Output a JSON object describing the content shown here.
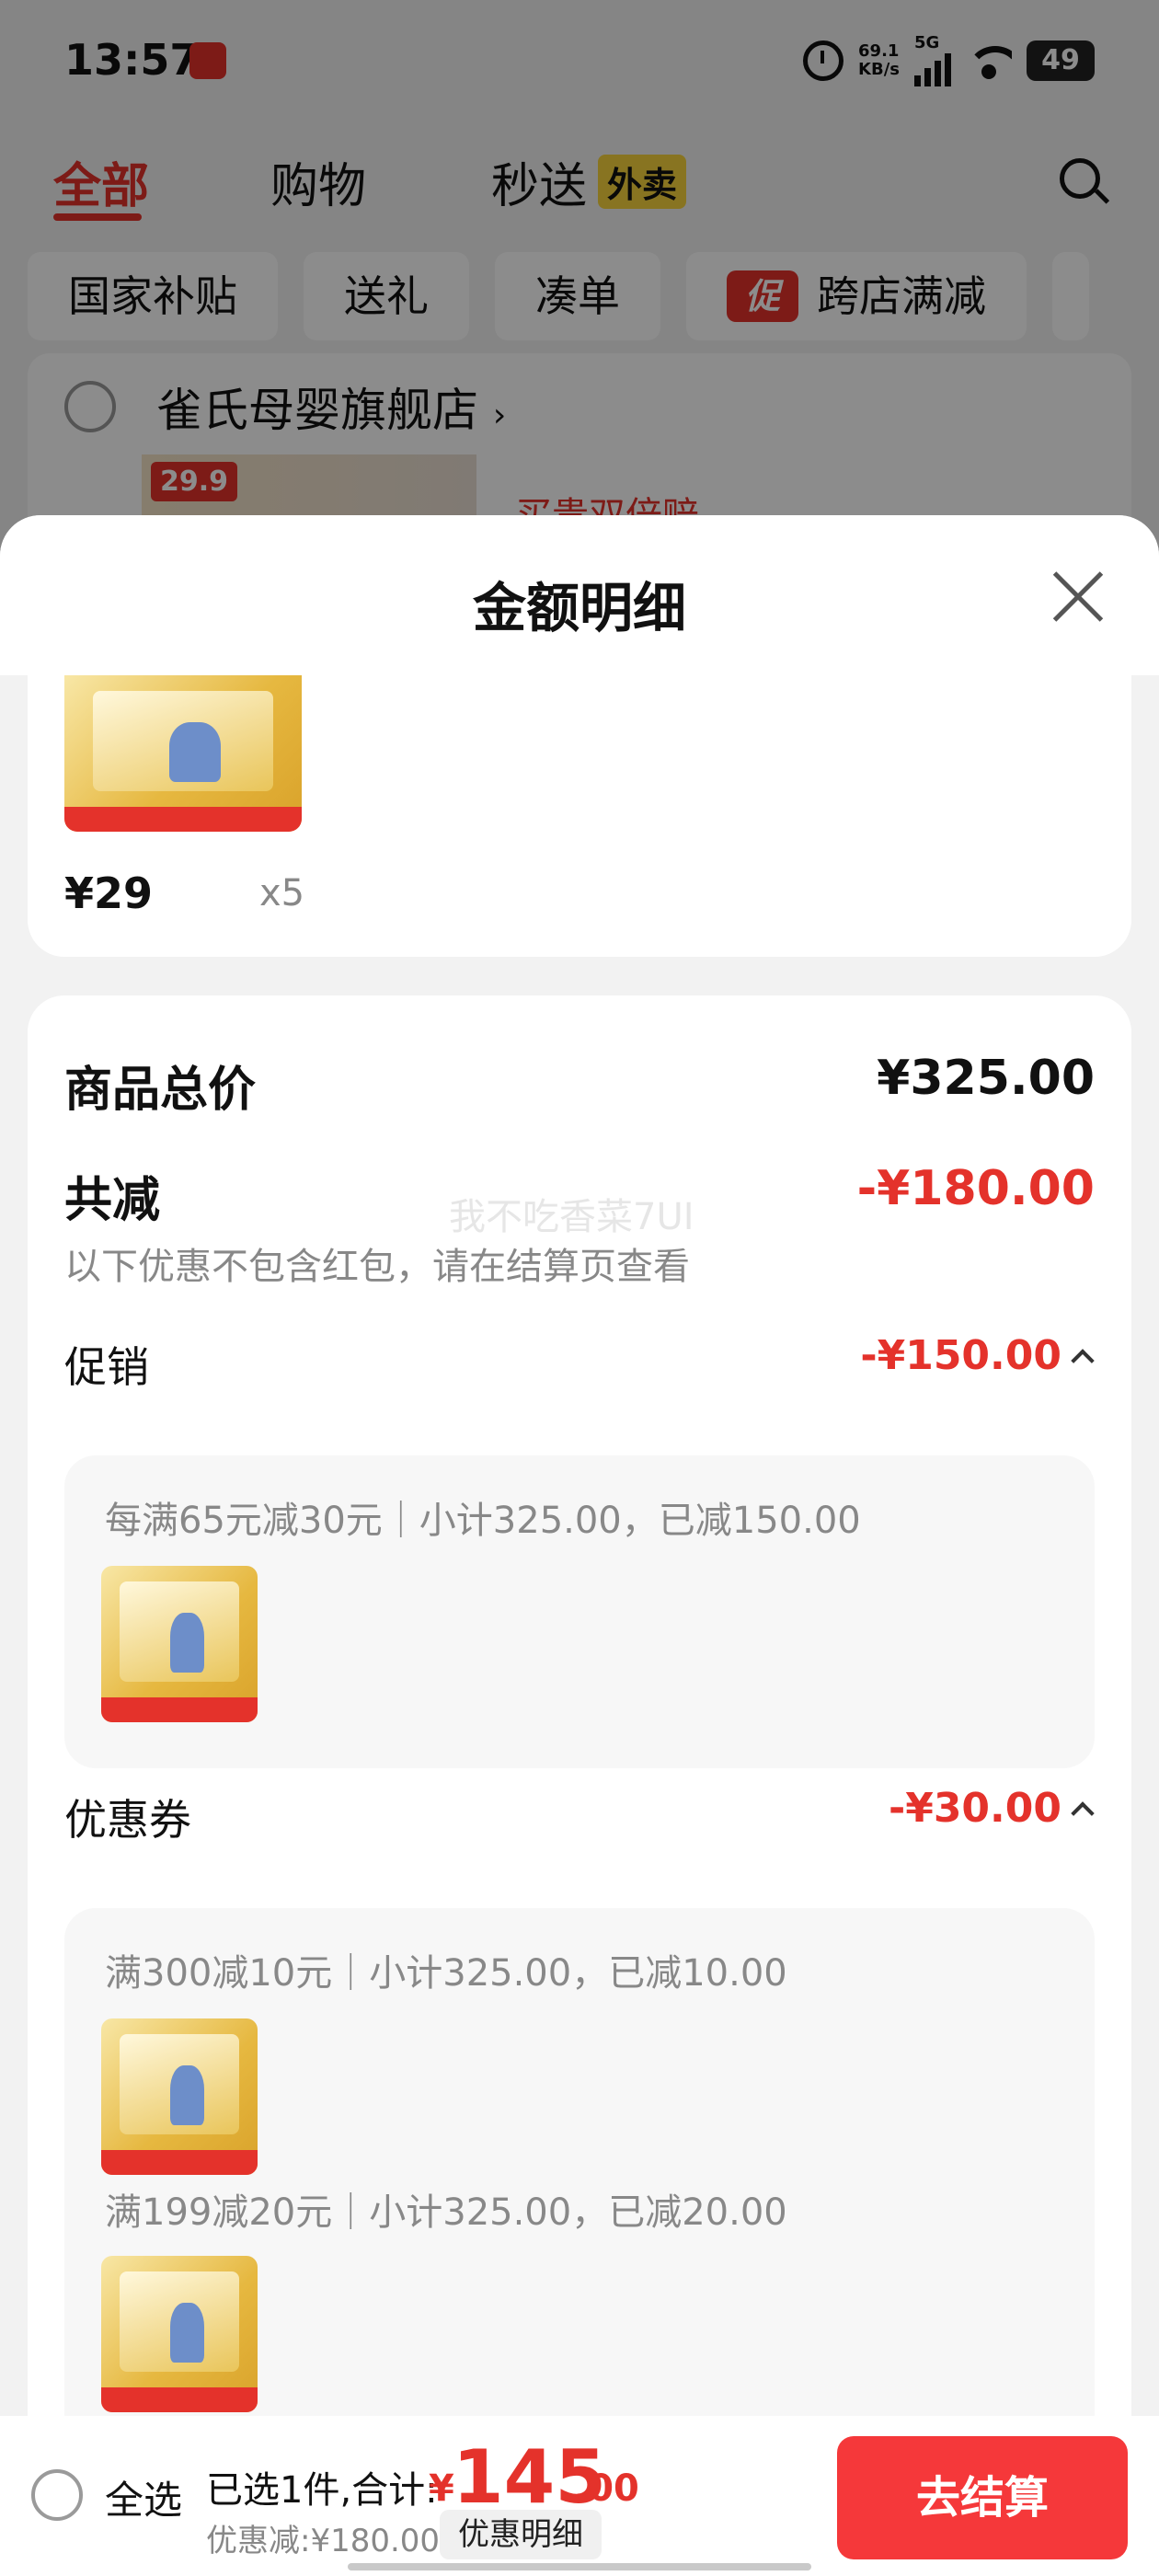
{
  "status_bar": {
    "time": "13:57",
    "net_speed_value": "69.1",
    "net_speed_unit": "KB/s",
    "network": "5G",
    "battery": "49",
    "app_icon": "red-app-icon"
  },
  "top_tabs": [
    {
      "label": "全部"
    },
    {
      "label": "购物"
    },
    {
      "label": "秒送"
    }
  ],
  "tab_badge": "外卖",
  "filter_chips": [
    "国家补贴",
    "送礼",
    "凑单",
    "跨店满减"
  ],
  "promo_tag": "促",
  "shop": {
    "name": "雀氏母婴旗舰店",
    "banner_price": "29.9",
    "promo": "买贵双倍赔"
  },
  "sheet": {
    "title": "金额明细"
  },
  "item": {
    "price": "¥29",
    "qty": "x5"
  },
  "summary": {
    "total_label": "商品总价",
    "total_value": "¥325.00",
    "reduce_label": "共减",
    "reduce_value": "-¥180.00",
    "note": "以下优惠不包含红包，请在结算页查看",
    "watermark": "我不吃香菜7UI"
  },
  "promotion": {
    "label": "促销",
    "amount": "-¥150.00",
    "rules": [
      "每满65元减30元｜小计325.00，已减150.00"
    ]
  },
  "coupon": {
    "label": "优惠券",
    "amount": "-¥30.00",
    "rules": [
      "满300减10元｜小计325.00，已减10.00",
      "满199减20元｜小计325.00，已减20.00"
    ]
  },
  "bottom_bar": {
    "select_all": "全选",
    "selected_text": "已选1件,合计:",
    "currency": "¥",
    "total_int": "145",
    "total_dec": ".00",
    "discount_text": "优惠减:¥180.00",
    "discount_button": "优惠明细",
    "checkout": "去结算"
  }
}
